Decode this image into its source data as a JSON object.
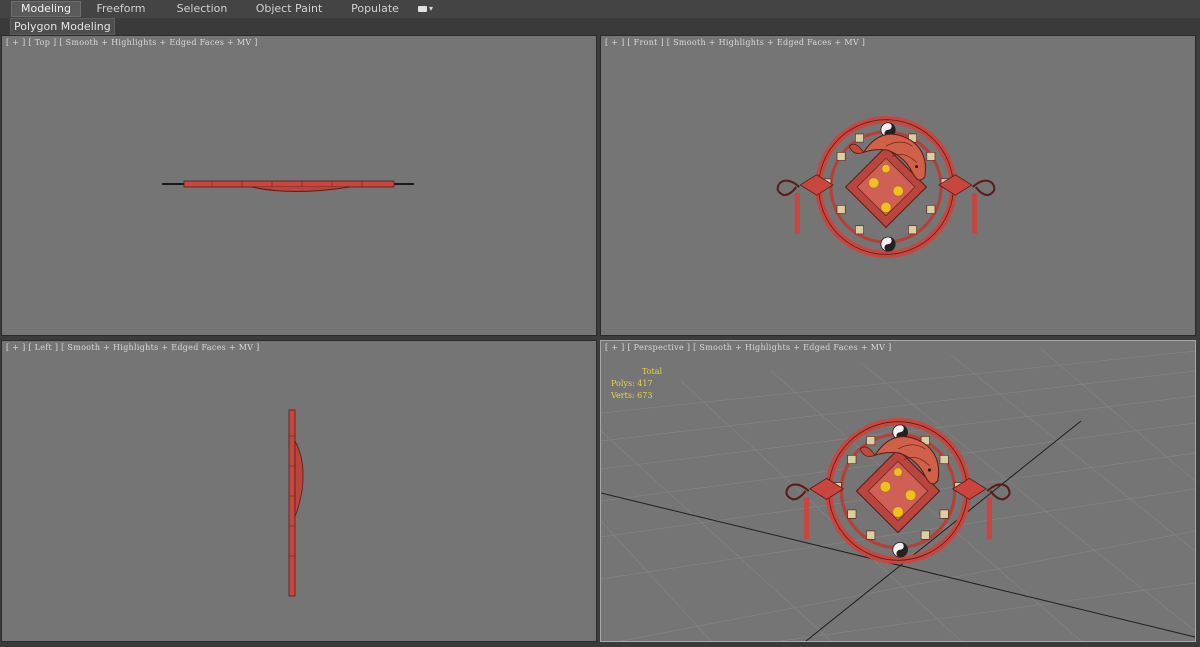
{
  "ribbon": {
    "tabs": [
      {
        "label": "Modeling",
        "active": true
      },
      {
        "label": "Freeform",
        "active": false
      },
      {
        "label": "Selection",
        "active": false
      },
      {
        "label": "Object Paint",
        "active": false
      },
      {
        "label": "Populate",
        "active": false
      }
    ],
    "panel_label": "Polygon Modeling"
  },
  "viewports": {
    "top": {
      "label": "[ + ] [ Top ] [ Smooth + Highlights + Edged Faces + MV ]"
    },
    "front": {
      "label": "[ + ] [ Front ] [ Smooth + Highlights + Edged Faces + MV ]"
    },
    "left": {
      "label": "[ + ] [ Left ] [ Smooth + Highlights + Edged Faces + MV ]"
    },
    "perspective": {
      "label": "[ + ] [ Perspective ] [ Smooth + Highlights + Edged Faces + MV ]"
    }
  },
  "stats": {
    "total_label": "Total",
    "polys": "Polys: 417",
    "verts": "Verts: 673"
  },
  "colors": {
    "viewport_bg": "#757575",
    "model_red": "#c8463e",
    "model_wire": "#5a1c18",
    "stats_text": "#e8d44a",
    "active_border": "#a8a8a8"
  }
}
